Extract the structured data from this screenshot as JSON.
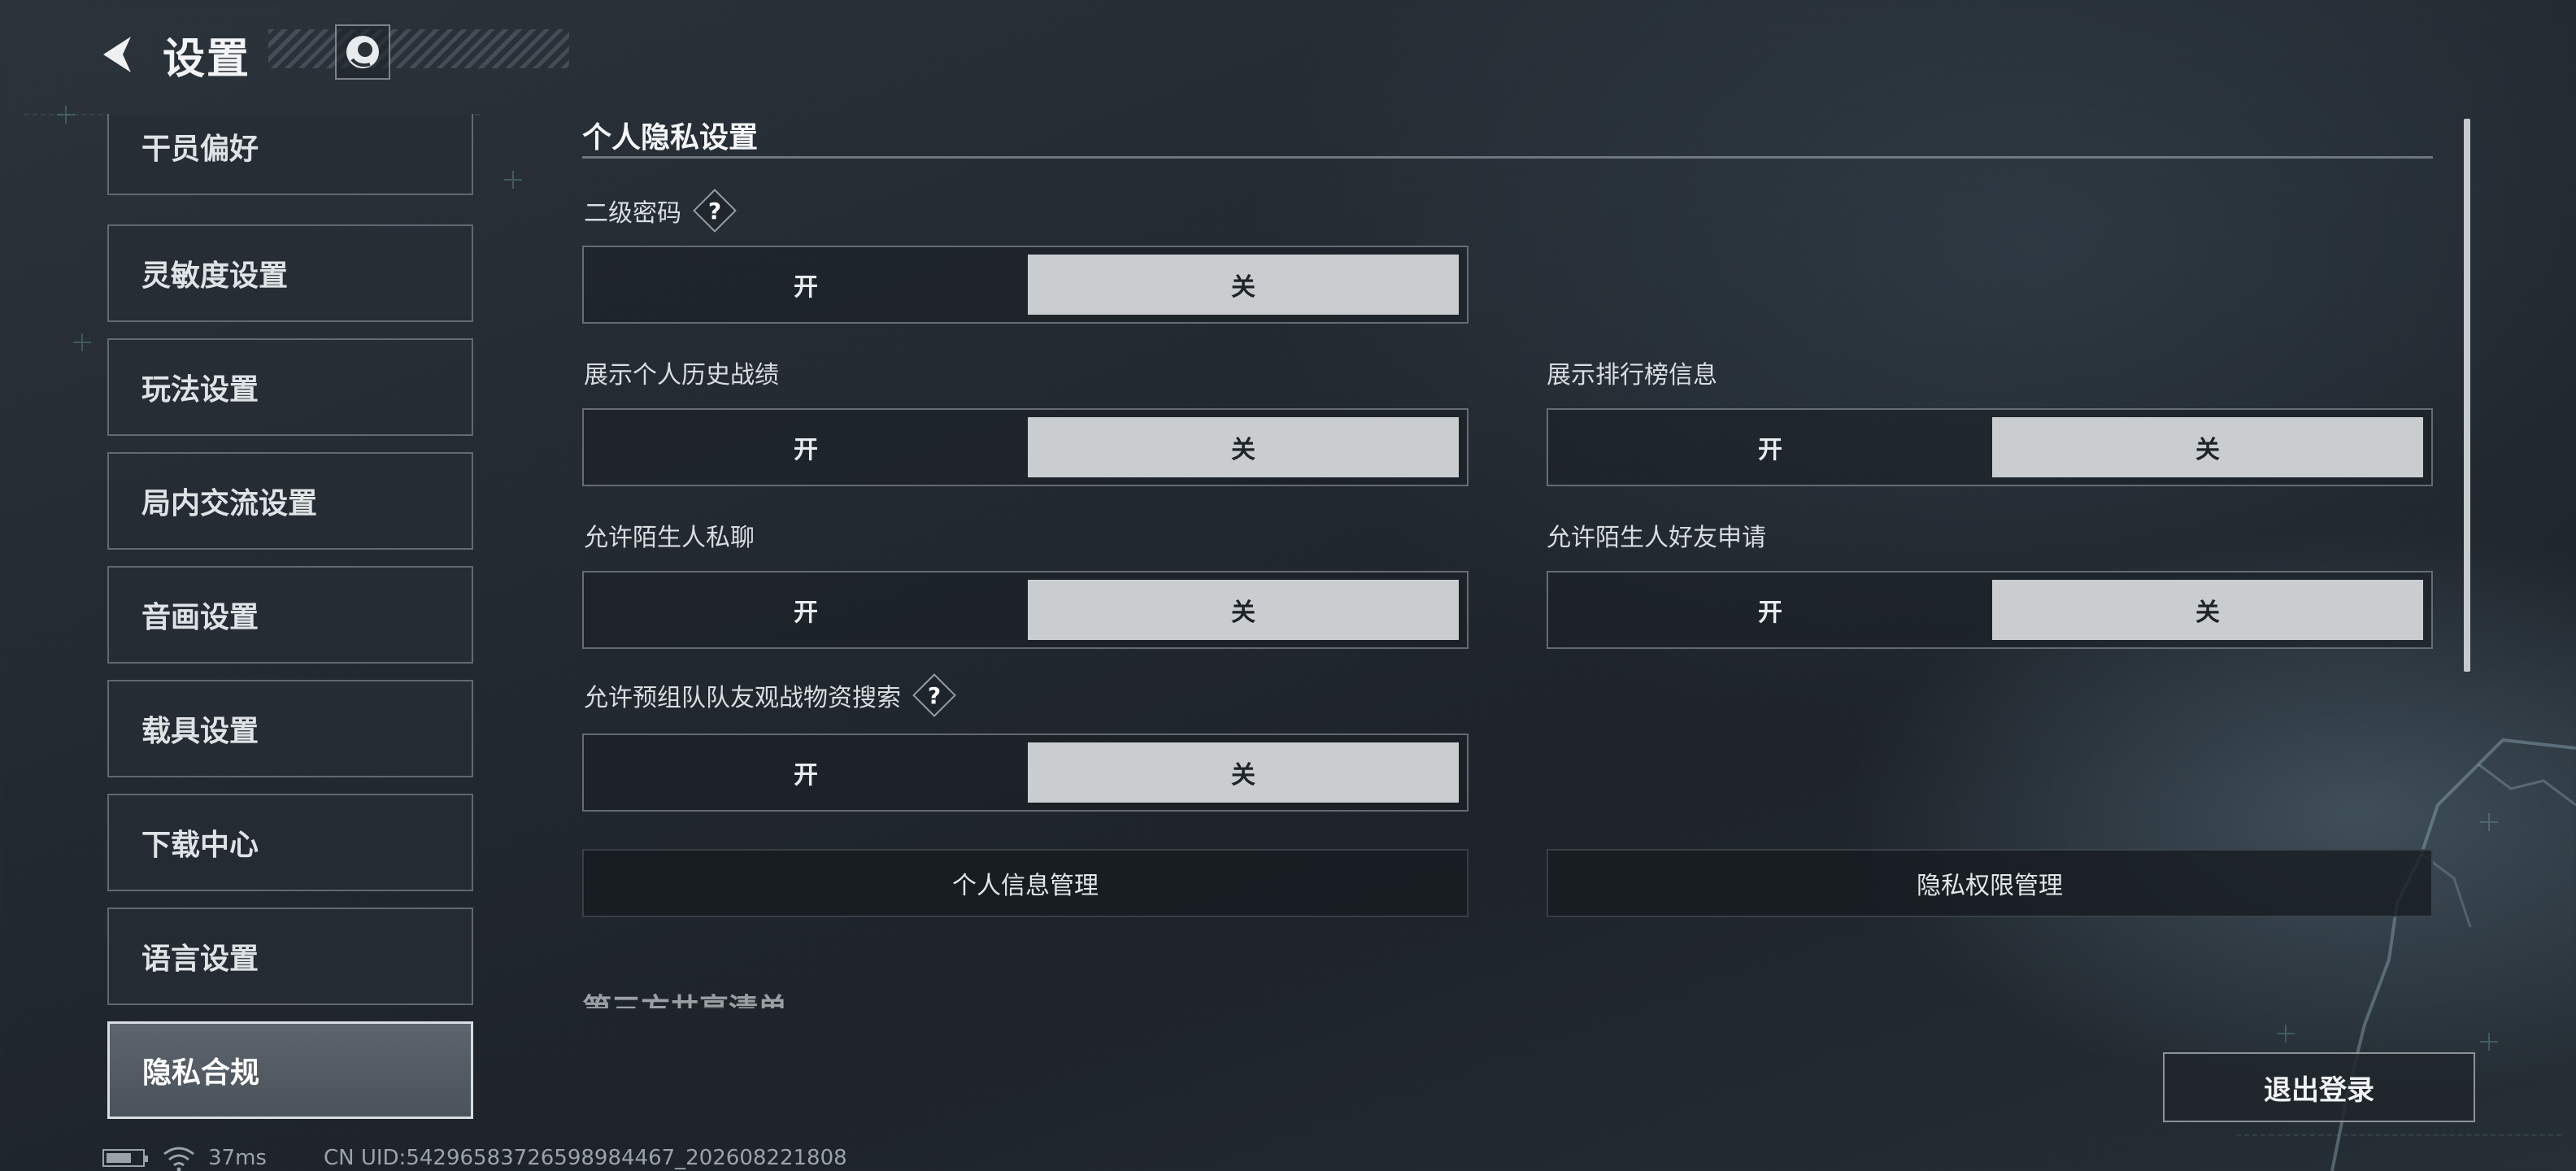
{
  "header": {
    "title": "设置",
    "back_icon": "back-arrow-icon",
    "logo_icon": "game-logo-icon"
  },
  "sidebar": {
    "items": [
      {
        "label": "干员偏好",
        "active": false
      },
      {
        "label": "灵敏度设置",
        "active": false
      },
      {
        "label": "玩法设置",
        "active": false
      },
      {
        "label": "局内交流设置",
        "active": false
      },
      {
        "label": "音画设置",
        "active": false
      },
      {
        "label": "载具设置",
        "active": false
      },
      {
        "label": "下载中心",
        "active": false
      },
      {
        "label": "语言设置",
        "active": false
      },
      {
        "label": "隐私合规",
        "active": true
      }
    ]
  },
  "privacy": {
    "section_title": "个人隐私设置",
    "settings": [
      {
        "label": "二级密码",
        "has_help": true,
        "on_label": "开",
        "off_label": "关",
        "value": "关"
      },
      {
        "label": "展示个人历史战绩",
        "has_help": false,
        "on_label": "开",
        "off_label": "关",
        "value": "关"
      },
      {
        "label": "展示排行榜信息",
        "has_help": false,
        "on_label": "开",
        "off_label": "关",
        "value": "关"
      },
      {
        "label": "允许陌生人私聊",
        "has_help": false,
        "on_label": "开",
        "off_label": "关",
        "value": "关"
      },
      {
        "label": "允许陌生人好友申请",
        "has_help": false,
        "on_label": "开",
        "off_label": "关",
        "value": "关"
      },
      {
        "label": "允许预组队队友观战物资搜索",
        "has_help": true,
        "on_label": "开",
        "off_label": "关",
        "value": "关"
      }
    ],
    "help_glyph": "?",
    "buttons": {
      "personal_info": "个人信息管理",
      "privacy_permissions": "隐私权限管理"
    },
    "next_section_cut": "第三方共享清单"
  },
  "logout_label": "退出登录",
  "status": {
    "ping": "37ms",
    "uid": "CN UID:54296583726598984467_202608221808"
  },
  "colors": {
    "selected_bg": "#c9cdd0",
    "active_nav_border": "#d8dde1",
    "accent_grid": "#6fa9a0"
  }
}
